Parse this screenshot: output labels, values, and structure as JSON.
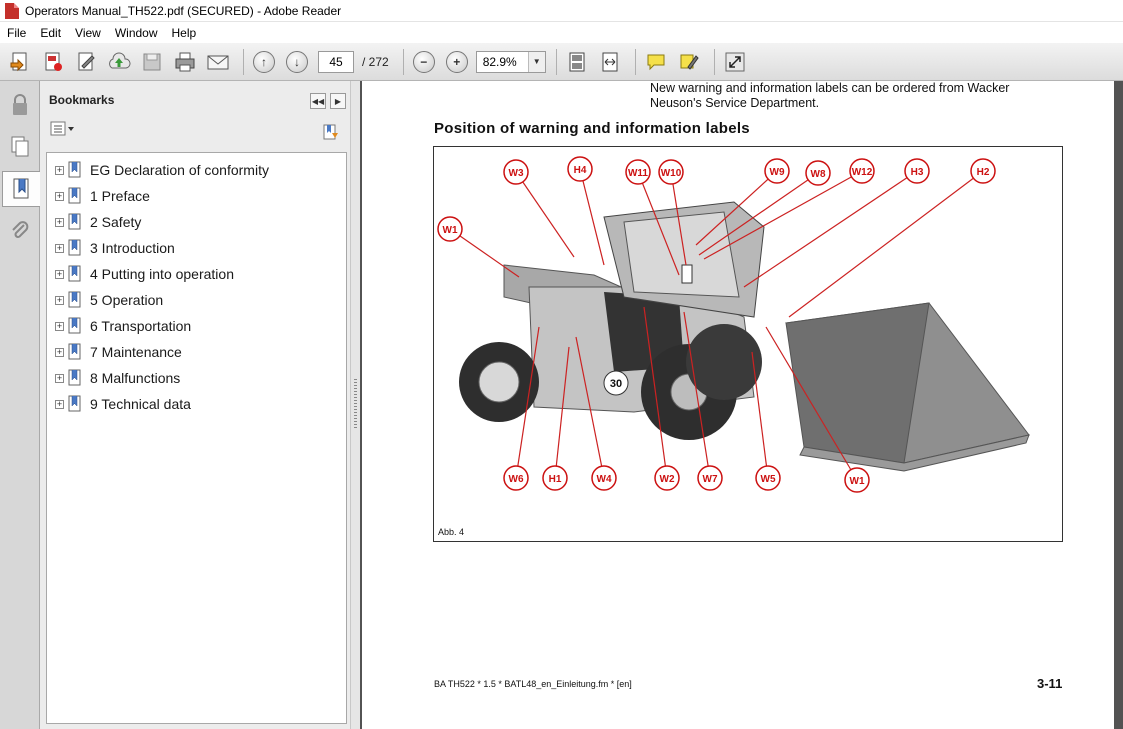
{
  "window": {
    "title": "Operators Manual_TH522.pdf (SECURED) - Adobe Reader"
  },
  "menu": [
    "File",
    "Edit",
    "View",
    "Window",
    "Help"
  ],
  "toolbar": {
    "current_page": "45",
    "total_pages": "/ 272",
    "zoom": "82.9%",
    "icons": [
      "create-pdf-icon",
      "edit-pdf-icon",
      "sign-icon",
      "upload-icon",
      "save-icon",
      "print-icon",
      "email-icon",
      "previous-page-icon",
      "next-page-icon",
      "zoom-out-icon",
      "zoom-in-icon",
      "fit-page-icon",
      "fit-width-icon",
      "comment-icon",
      "highlight-icon",
      "expand-icon"
    ]
  },
  "sidebar": {
    "title": "Bookmarks",
    "items": [
      {
        "label": "EG Declaration of conformity"
      },
      {
        "label": "1 Preface"
      },
      {
        "label": "2 Safety"
      },
      {
        "label": "3 Introduction"
      },
      {
        "label": "4 Putting into operation"
      },
      {
        "label": "5 Operation"
      },
      {
        "label": "6 Transportation"
      },
      {
        "label": "7 Maintenance"
      },
      {
        "label": "8 Malfunctions"
      },
      {
        "label": "9 Technical data"
      }
    ]
  },
  "document": {
    "intro_line1": "New warning and information labels can be ordered from Wacker",
    "intro_line2": "Neuson's Service Department.",
    "heading": "Position of warning and information labels",
    "figure_caption": "Abb. 4",
    "footer_left": "BA TH522 * 1.5 * BATL48_en_Einleitung.fm * [en]",
    "footer_right": "3-11",
    "vehicle_number": "30",
    "callouts": {
      "w3": "W3",
      "h4": "H4",
      "w11": "W11",
      "w10": "W10",
      "w9": "W9",
      "w8": "W8",
      "w12": "W12",
      "h3": "H3",
      "h2": "H2",
      "w1a": "W1",
      "w6": "W6",
      "h1": "H1",
      "w4": "W4",
      "w2": "W2",
      "w7": "W7",
      "w5": "W5",
      "w1b": "W1"
    }
  }
}
